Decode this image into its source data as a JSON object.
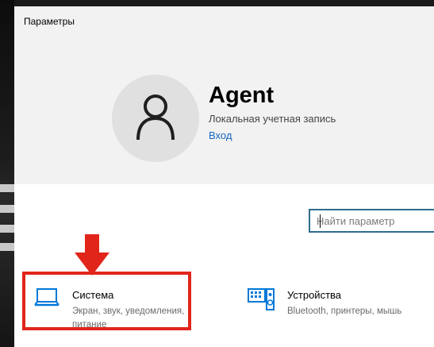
{
  "window": {
    "title": "Параметры"
  },
  "account": {
    "name": "Agent",
    "type": "Локальная учетная запись",
    "sign_in": "Вход"
  },
  "search": {
    "placeholder": "Найти параметр"
  },
  "categories": [
    {
      "title": "Система",
      "description": "Экран, звук, уведомления, питание",
      "icon": "laptop-icon",
      "highlighted": true
    },
    {
      "title": "Устройства",
      "description": "Bluetooth, принтеры, мышь",
      "icon": "keyboard-speaker-icon",
      "highlighted": false
    }
  ],
  "colors": {
    "accent": "#0078d7",
    "highlight": "#e1251b",
    "link": "#1565c0"
  }
}
